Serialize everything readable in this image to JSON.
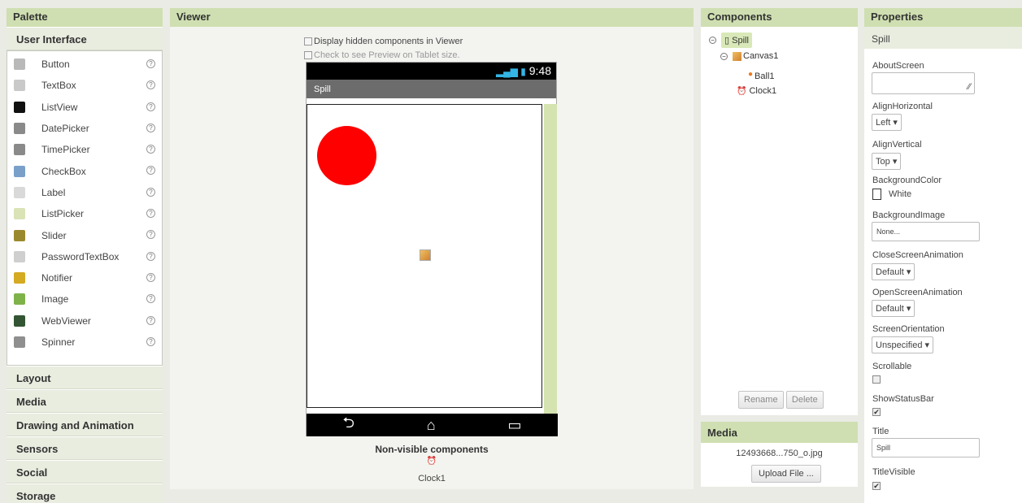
{
  "palette": {
    "header": "Palette",
    "open_category": "User Interface",
    "items": [
      {
        "label": "Button",
        "icon": "button-icon",
        "color": "#b9b9b9"
      },
      {
        "label": "TextBox",
        "icon": "textbox-icon",
        "color": "#c9c9c9"
      },
      {
        "label": "ListView",
        "icon": "listview-icon",
        "color": "#111111"
      },
      {
        "label": "DatePicker",
        "icon": "datepicker-icon",
        "color": "#8a8a8a"
      },
      {
        "label": "TimePicker",
        "icon": "timepicker-icon",
        "color": "#8a8a8a"
      },
      {
        "label": "CheckBox",
        "icon": "checkbox-icon",
        "color": "#7aa0c9"
      },
      {
        "label": "Label",
        "icon": "label-icon",
        "color": "#d9d9d9"
      },
      {
        "label": "ListPicker",
        "icon": "listpicker-icon",
        "color": "#d9e3b6"
      },
      {
        "label": "Slider",
        "icon": "slider-icon",
        "color": "#9b8a2d"
      },
      {
        "label": "PasswordTextBox",
        "icon": "passwordtextbox-icon",
        "color": "#cfcfcf"
      },
      {
        "label": "Notifier",
        "icon": "notifier-icon",
        "color": "#d4aa22"
      },
      {
        "label": "Image",
        "icon": "image-icon",
        "color": "#7fb34a"
      },
      {
        "label": "WebViewer",
        "icon": "webviewer-icon",
        "color": "#335533"
      },
      {
        "label": "Spinner",
        "icon": "spinner-icon",
        "color": "#8f8f8f"
      }
    ],
    "categories": [
      "Layout",
      "Media",
      "Drawing and Animation",
      "Sensors",
      "Social",
      "Storage"
    ],
    "help_glyph": "?"
  },
  "viewer": {
    "header": "Viewer",
    "hidden_label": "Display hidden components in Viewer",
    "tablet_label": "Check to see Preview on Tablet size.",
    "status_time": "9:48",
    "status_icons": "📶",
    "screen_title": "Spill",
    "ball_color": "#fe0000",
    "nav_back": "⮌",
    "nav_home": "⌂",
    "nav_recent": "▭",
    "nonvisible_label": "Non-visible components",
    "nonvisible_item": "Clock1"
  },
  "components": {
    "header": "Components",
    "tree": {
      "screen": "Spill",
      "canvas": "Canvas1",
      "ball": "Ball1",
      "clock": "Clock1"
    },
    "rename": "Rename",
    "delete": "Delete"
  },
  "media": {
    "header": "Media",
    "file": "12493668...750_o.jpg",
    "upload": "Upload File ..."
  },
  "properties": {
    "header": "Properties",
    "component": "Spill",
    "about_screen": "AboutScreen",
    "align_horizontal": "AlignHorizontal",
    "align_horizontal_value": "Left",
    "align_vertical": "AlignVertical",
    "align_vertical_value": "Top",
    "background_color": "BackgroundColor",
    "background_color_value": "White",
    "background_image": "BackgroundImage",
    "background_image_value": "None...",
    "close_anim": "CloseScreenAnimation",
    "close_anim_value": "Default",
    "open_anim": "OpenScreenAnimation",
    "open_anim_value": "Default",
    "orientation": "ScreenOrientation",
    "orientation_value": "Unspecified",
    "scrollable": "Scrollable",
    "show_status_bar": "ShowStatusBar",
    "title": "Title",
    "title_value": "Spill",
    "title_visible": "TitleVisible",
    "check_glyph": "✔",
    "dropdown_glyph": "▾"
  }
}
